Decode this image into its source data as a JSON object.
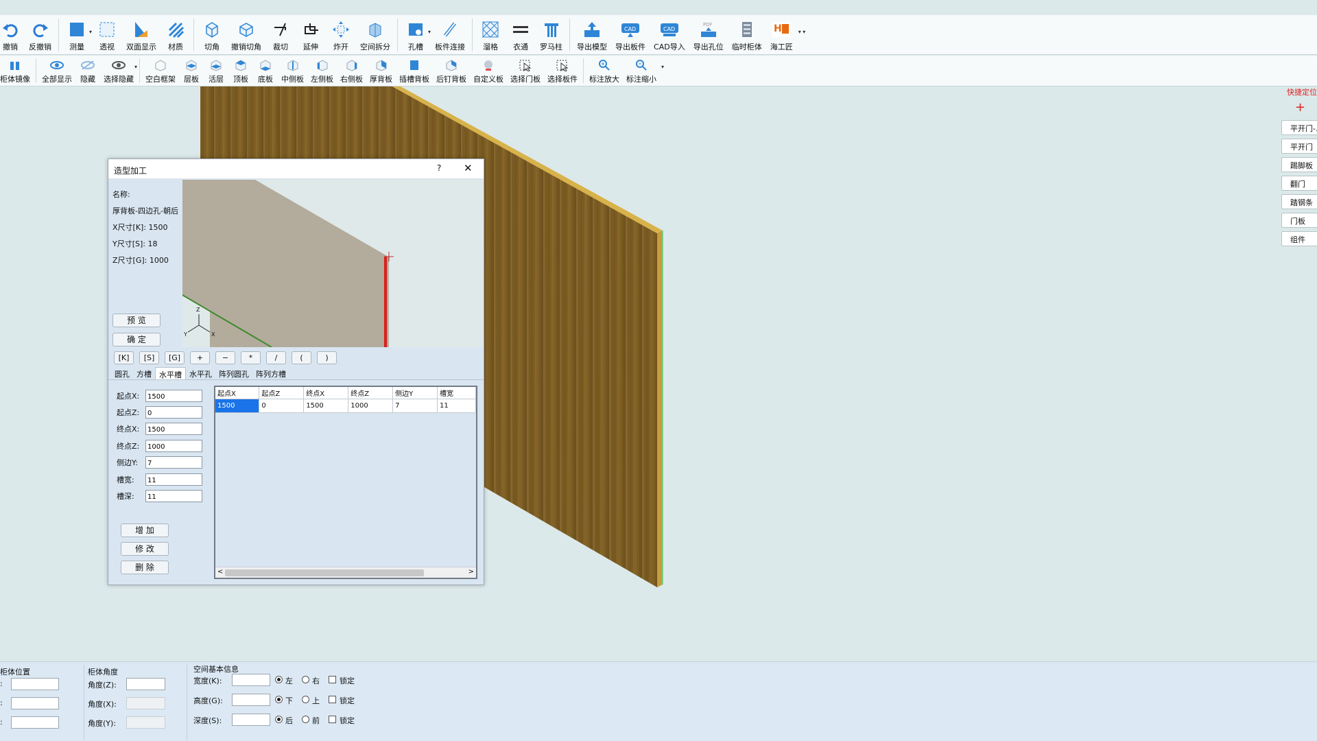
{
  "toolbar_main": [
    {
      "label": "撤销",
      "icon": "undo-icon"
    },
    {
      "label": "反撤销",
      "icon": "redo-icon"
    },
    {
      "label": "测量",
      "icon": "measure-icon"
    },
    {
      "label": "透视",
      "icon": "perspective-icon"
    },
    {
      "label": "双面显示",
      "icon": "double-side-icon"
    },
    {
      "label": "材质",
      "icon": "material-icon"
    },
    {
      "label": "切角",
      "icon": "chamfer-icon"
    },
    {
      "label": "撤销切角",
      "icon": "undo-chamfer-icon"
    },
    {
      "label": "裁切",
      "icon": "cut-icon"
    },
    {
      "label": "延伸",
      "icon": "extend-icon"
    },
    {
      "label": "炸开",
      "icon": "explode-icon"
    },
    {
      "label": "空间拆分",
      "icon": "split-space-icon"
    },
    {
      "label": "孔槽",
      "icon": "hole-slot-icon"
    },
    {
      "label": "板件连接",
      "icon": "board-connect-icon"
    },
    {
      "label": "溜格",
      "icon": "grid-icon"
    },
    {
      "label": "衣通",
      "icon": "rail-icon"
    },
    {
      "label": "罗马柱",
      "icon": "roman-column-icon"
    },
    {
      "label": "导出模型",
      "icon": "export-model-icon"
    },
    {
      "label": "导出板件",
      "icon": "export-cad-board-icon"
    },
    {
      "label": "CAD导入",
      "icon": "cad-import-icon"
    },
    {
      "label": "导出孔位",
      "icon": "export-hole-pdf-icon"
    },
    {
      "label": "临时柜体",
      "icon": "temp-cabinet-icon"
    },
    {
      "label": "海工匠",
      "icon": "haigongjiang-icon"
    }
  ],
  "toolbar_secondary": [
    {
      "label": "柜体镜像",
      "icon": "mirror-icon"
    },
    {
      "label": "全部显示",
      "icon": "eye-icon"
    },
    {
      "label": "隐藏",
      "icon": "hide-icon"
    },
    {
      "label": "选择隐藏",
      "icon": "select-hide-icon"
    },
    {
      "label": "空白框架",
      "icon": "blank-frame-icon"
    },
    {
      "label": "层板",
      "icon": "shelf-icon"
    },
    {
      "label": "活层",
      "icon": "movable-shelf-icon"
    },
    {
      "label": "顶板",
      "icon": "top-board-icon"
    },
    {
      "label": "底板",
      "icon": "bottom-board-icon"
    },
    {
      "label": "中侧板",
      "icon": "mid-side-icon"
    },
    {
      "label": "左侧板",
      "icon": "left-side-icon"
    },
    {
      "label": "右侧板",
      "icon": "right-side-icon"
    },
    {
      "label": "厚背板",
      "icon": "thick-back-icon"
    },
    {
      "label": "插槽背板",
      "icon": "slot-back-icon"
    },
    {
      "label": "后钉背板",
      "icon": "nail-back-icon"
    },
    {
      "label": "自定义板",
      "icon": "custom-board-icon"
    },
    {
      "label": "选择门板",
      "icon": "select-door-icon"
    },
    {
      "label": "选择板件",
      "icon": "select-board-icon"
    },
    {
      "label": "标注放大",
      "icon": "zoom-in-icon"
    },
    {
      "label": "标注缩小",
      "icon": "zoom-out-icon"
    }
  ],
  "quick_panel": {
    "title": "快捷定位",
    "plus": "+",
    "buttons": [
      "平开门-...",
      "平开门",
      "踢脚板",
      "翻门",
      "踏钢条",
      "门板",
      "组件"
    ]
  },
  "dialog": {
    "title": "造型加工",
    "help": "?",
    "close": "✕",
    "name_label": "名称:",
    "name_value": "厚背板-四边孔-朝后",
    "x_size": "X尺寸[K]: 1500",
    "y_size": "Y尺寸[S]: 18",
    "z_size": "Z尺寸[G]: 1000",
    "preview_button": "预 览",
    "confirm_button": "确 定",
    "axis": {
      "z": "Z",
      "y": "Y",
      "x": "X"
    },
    "operators": [
      "[K]",
      "[S]",
      "[G]",
      "+",
      "−",
      "*",
      "/",
      "(",
      ")"
    ],
    "tabs": [
      "圆孔",
      "方槽",
      "水平槽",
      "水平孔",
      "阵列圆孔",
      "阵列方槽"
    ],
    "active_tab": 2,
    "fields": [
      {
        "label": "起点X:",
        "value": "1500"
      },
      {
        "label": "起点Z:",
        "value": "0"
      },
      {
        "label": "终点X:",
        "value": "1500"
      },
      {
        "label": "终点Z:",
        "value": "1000"
      },
      {
        "label": "侧边Y:",
        "value": "7"
      },
      {
        "label": "槽宽:",
        "value": "11"
      },
      {
        "label": "槽深:",
        "value": "11"
      }
    ],
    "add_button": "增 加",
    "modify_button": "修 改",
    "delete_button": "删 除",
    "grid": {
      "columns": [
        "起点X",
        "起点Z",
        "终点X",
        "终点Z",
        "侧边Y",
        "槽宽"
      ],
      "rows": [
        [
          "1500",
          "0",
          "1500",
          "1000",
          "7",
          "11"
        ]
      ]
    }
  },
  "bottom": {
    "position_group": "柜体位置",
    "position_labels": [
      ":",
      ":",
      ":"
    ],
    "angle_group": "柜体角度",
    "angle_labels": [
      "角度(Z):",
      "角度(X):",
      "角度(Y):"
    ],
    "space_group": "空间基本信息",
    "space_rows": [
      {
        "label": "宽度(K):",
        "opt1": "左",
        "opt2": "右",
        "lock": "锁定"
      },
      {
        "label": "高度(G):",
        "opt1": "下",
        "opt2": "上",
        "lock": "锁定"
      },
      {
        "label": "深度(S):",
        "opt1": "后",
        "opt2": "前",
        "lock": "锁定"
      }
    ]
  }
}
